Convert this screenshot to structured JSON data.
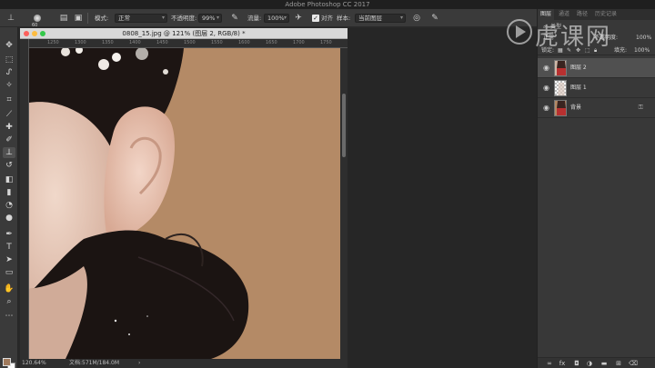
{
  "app": {
    "title": "Adobe Photoshop CC 2017"
  },
  "options_bar": {
    "brush_size": "60",
    "mode_label": "模式:",
    "mode_value": "正常",
    "opacity_label": "不透明度:",
    "opacity_value": "99%",
    "flow_label": "流量:",
    "flow_value": "100%",
    "aligned_label": "对齐",
    "sample_label": "样本:",
    "sample_value": "当前图层"
  },
  "document": {
    "title": "0808_15.jpg @ 121% (图层 2, RGB/8) *",
    "ruler_ticks": [
      "1250",
      "1300",
      "1350",
      "1400",
      "1450",
      "1500",
      "1550",
      "1600",
      "1650",
      "1700",
      "1750"
    ],
    "zoom": "120.64%",
    "doc_size": "文档:571M/184.0M"
  },
  "panels": {
    "tabs": [
      "图层",
      "通道",
      "路径",
      "历史记录"
    ],
    "kind_label": "类型",
    "blend_mode": "正常",
    "opacity_label": "不透明度:",
    "opacity_value": "100%",
    "lock_label": "锁定:",
    "fill_label": "填充:",
    "fill_value": "100%",
    "layers": [
      {
        "name": "图层 2",
        "selected": true,
        "locked": false
      },
      {
        "name": "图层 1",
        "selected": false,
        "locked": false
      },
      {
        "name": "背景",
        "selected": false,
        "locked": true
      }
    ]
  },
  "watermark": {
    "text": "虎课网"
  },
  "colors": {
    "foreground": "#a07a5c",
    "background": "#fafafa",
    "canvas_bg": "#b48a66",
    "hair": "#1b1412",
    "skin": "#e8cbbb"
  },
  "icons": [
    "stamp-icon",
    "brush-preset-icon",
    "pressure-opacity-icon",
    "pressure-size-icon",
    "eye-icon",
    "lock-icon",
    "link-icon",
    "fx-icon",
    "mask-icon",
    "adjustment-icon",
    "folder-icon",
    "new-layer-icon",
    "trash-icon"
  ]
}
